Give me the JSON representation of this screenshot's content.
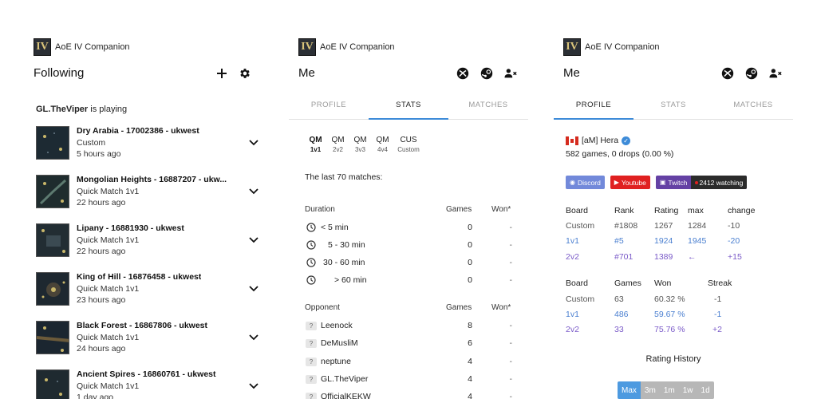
{
  "app": {
    "title": "AoE IV Companion",
    "logo_text": "IV"
  },
  "following": {
    "title": "Following",
    "playing_name": "GL.TheViper",
    "playing_suffix": " is playing",
    "matches": [
      {
        "title": "Dry Arabia - 17002386 - ukwest",
        "type": "Custom",
        "time": "5 hours ago"
      },
      {
        "title": "Mongolian Heights - 16887207 - ukw...",
        "type": "Quick Match 1v1",
        "time": "22 hours ago"
      },
      {
        "title": "Lipany - 16881930 - ukwest",
        "type": "Quick Match 1v1",
        "time": "22 hours ago"
      },
      {
        "title": "King of Hill - 16876458 - ukwest",
        "type": "Quick Match 1v1",
        "time": "23 hours ago"
      },
      {
        "title": "Black Forest - 16867806 - ukwest",
        "type": "Quick Match 1v1",
        "time": "24 hours ago"
      },
      {
        "title": "Ancient Spires - 16860761 - ukwest",
        "type": "Quick Match 1v1",
        "time": "1 day ago"
      }
    ]
  },
  "me": {
    "title": "Me",
    "tabs": [
      "PROFILE",
      "STATS",
      "MATCHES"
    ]
  },
  "stats": {
    "modes": [
      {
        "top": "QM",
        "sub": "1v1"
      },
      {
        "top": "QM",
        "sub": "2v2"
      },
      {
        "top": "QM",
        "sub": "3v3"
      },
      {
        "top": "QM",
        "sub": "4v4"
      },
      {
        "top": "CUS",
        "sub": "Custom"
      }
    ],
    "last_matches": "The last 70 matches:",
    "duration": {
      "header": "Duration",
      "games_header": "Games",
      "won_header": "Won*",
      "rows": [
        {
          "label": "< 5 min",
          "games": "0",
          "won": "-"
        },
        {
          "label": "5 - 30 min",
          "games": "0",
          "won": "-"
        },
        {
          "label": "30 - 60 min",
          "games": "0",
          "won": "-"
        },
        {
          "label": "> 60 min",
          "games": "0",
          "won": "-"
        }
      ]
    },
    "opponent": {
      "header": "Opponent",
      "games_header": "Games",
      "won_header": "Won*",
      "rows": [
        {
          "name": "Leenock",
          "games": "8",
          "won": "-"
        },
        {
          "name": "DeMusliM",
          "games": "6",
          "won": "-"
        },
        {
          "name": "neptune",
          "games": "4",
          "won": "-"
        },
        {
          "name": "GL.TheViper",
          "games": "4",
          "won": "-"
        },
        {
          "name": "OfficialKEKW",
          "games": "4",
          "won": "-"
        }
      ],
      "unknown_mark": "?"
    }
  },
  "profile": {
    "name": "[aM] Hera",
    "summary": "582 games, 0 drops (0.00 %)",
    "badges": {
      "discord": "Discord",
      "youtube": "Youtube",
      "twitch": "Twitch",
      "watching": "2412 watching"
    },
    "rank_table": {
      "headers": [
        "Board",
        "Rank",
        "Rating",
        "max",
        "change"
      ],
      "rows": [
        [
          "Custom",
          "#1808",
          "1267",
          "1284",
          "-10"
        ],
        [
          "1v1",
          "#5",
          "1924",
          "1945",
          "-20"
        ],
        [
          "2v2",
          "#701",
          "1389",
          "←",
          "+15"
        ]
      ]
    },
    "games_table": {
      "headers": [
        "Board",
        "Games",
        "Won",
        "Streak"
      ],
      "rows": [
        [
          "Custom",
          "63",
          "60.32 %",
          "-1"
        ],
        [
          "1v1",
          "486",
          "59.67 %",
          "-1"
        ],
        [
          "2v2",
          "33",
          "75.76 %",
          "+2"
        ]
      ]
    },
    "rating_history": "Rating History",
    "ranges": [
      "Max",
      "3m",
      "1m",
      "1w",
      "1d"
    ]
  },
  "colors": {
    "accent": "#3d8bd8",
    "link": "#4a7fd0",
    "purple": "#7a5ac8",
    "discord": "#7289da",
    "youtube": "#e02020",
    "twitch": "#6441a4"
  },
  "icons": [
    "plus-icon",
    "gear-icon",
    "xbox-icon",
    "steam-icon",
    "remove-user-icon",
    "chevron-down-icon",
    "clock-icon",
    "verified-icon",
    "canada-flag-icon"
  ]
}
